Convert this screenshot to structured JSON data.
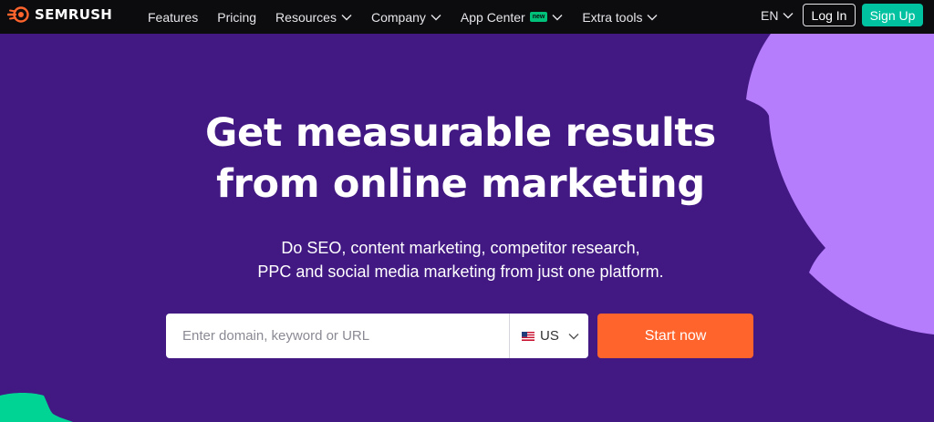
{
  "brand": {
    "name": "SEMRUSH",
    "logo_color": "#ff642d",
    "icon": "semrush-fire-icon"
  },
  "nav": {
    "items": [
      {
        "label": "Features",
        "has_dropdown": false
      },
      {
        "label": "Pricing",
        "has_dropdown": false
      },
      {
        "label": "Resources",
        "has_dropdown": true
      },
      {
        "label": "Company",
        "has_dropdown": true
      },
      {
        "label": "App Center",
        "has_dropdown": true,
        "badge": "new"
      },
      {
        "label": "Extra tools",
        "has_dropdown": true
      }
    ]
  },
  "header_right": {
    "language": "EN",
    "login_label": "Log In",
    "signup_label": "Sign Up"
  },
  "hero": {
    "title_line1": "Get measurable results",
    "title_line2": "from online marketing",
    "subtitle_line1": "Do SEO, content marketing, competitor research,",
    "subtitle_line2": "PPC and social media marketing from just one platform."
  },
  "search": {
    "placeholder": "Enter domain, keyword or URL",
    "value": "",
    "country": "US",
    "country_icon": "us-flag-icon",
    "button_label": "Start now"
  },
  "colors": {
    "background": "#421983",
    "topbar": "#0c0c0f",
    "accent_orange": "#ff642d",
    "signup_green": "#00c2a0",
    "blob_lilac": "#b57cfc",
    "blob_green": "#00d495"
  }
}
